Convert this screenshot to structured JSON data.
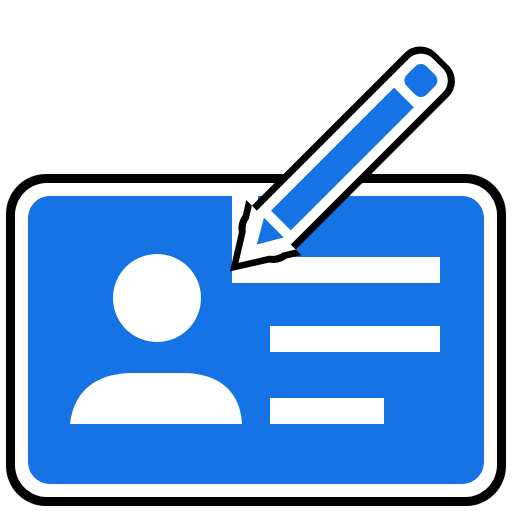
{
  "icon": {
    "name": "edit-id-card-icon",
    "colors": {
      "fill": "#1573E6",
      "outline": "#000000",
      "inner_stroke": "#FFFFFF"
    },
    "parts": [
      "id-card",
      "person-silhouette",
      "text-lines",
      "pencil"
    ]
  }
}
